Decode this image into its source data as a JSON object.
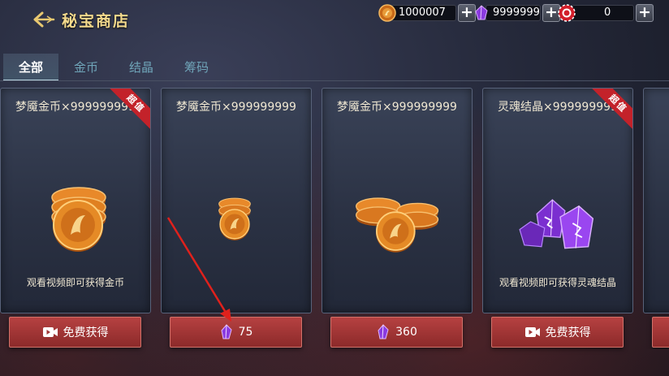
{
  "header": {
    "title": "秘宝商店",
    "currencies": [
      {
        "icon": "gold-coin-icon",
        "value": "1000007"
      },
      {
        "icon": "purple-crystal-icon",
        "value": "9999999"
      },
      {
        "icon": "chip-token-icon",
        "value": "0"
      }
    ]
  },
  "tabs": [
    {
      "label": "全部",
      "active": true
    },
    {
      "label": "金币",
      "active": false
    },
    {
      "label": "结晶",
      "active": false
    },
    {
      "label": "筹码",
      "active": false
    }
  ],
  "cards": [
    {
      "name": "梦魇金币×999999999",
      "desc": "观看视频即可获得金币",
      "art": "gold-coin-stack-icon",
      "badge": "超值",
      "button": {
        "icon": "video-icon",
        "label": "免费获得"
      }
    },
    {
      "name": "梦魇金币×999999999",
      "desc": "",
      "art": "gold-coin-stack-icon",
      "badge": "",
      "button": {
        "icon": "purple-crystal-icon",
        "label": "75"
      }
    },
    {
      "name": "梦魇金币×999999999",
      "desc": "",
      "art": "gold-coin-pile-icon",
      "badge": "",
      "button": {
        "icon": "purple-crystal-icon",
        "label": "360"
      }
    },
    {
      "name": "灵魂结晶×999999999",
      "desc": "观看视频即可获得灵魂结晶",
      "art": "purple-crystal-cluster-icon",
      "badge": "超值",
      "button": {
        "icon": "video-icon",
        "label": "免费获得"
      }
    }
  ],
  "colors": {
    "title": "#f3d98c",
    "tab_active": "#ffffff",
    "tab_inactive": "#6fa4b8",
    "button": "#a03636",
    "badge": "#c3222a",
    "annotation_arrow": "#e0211c"
  }
}
